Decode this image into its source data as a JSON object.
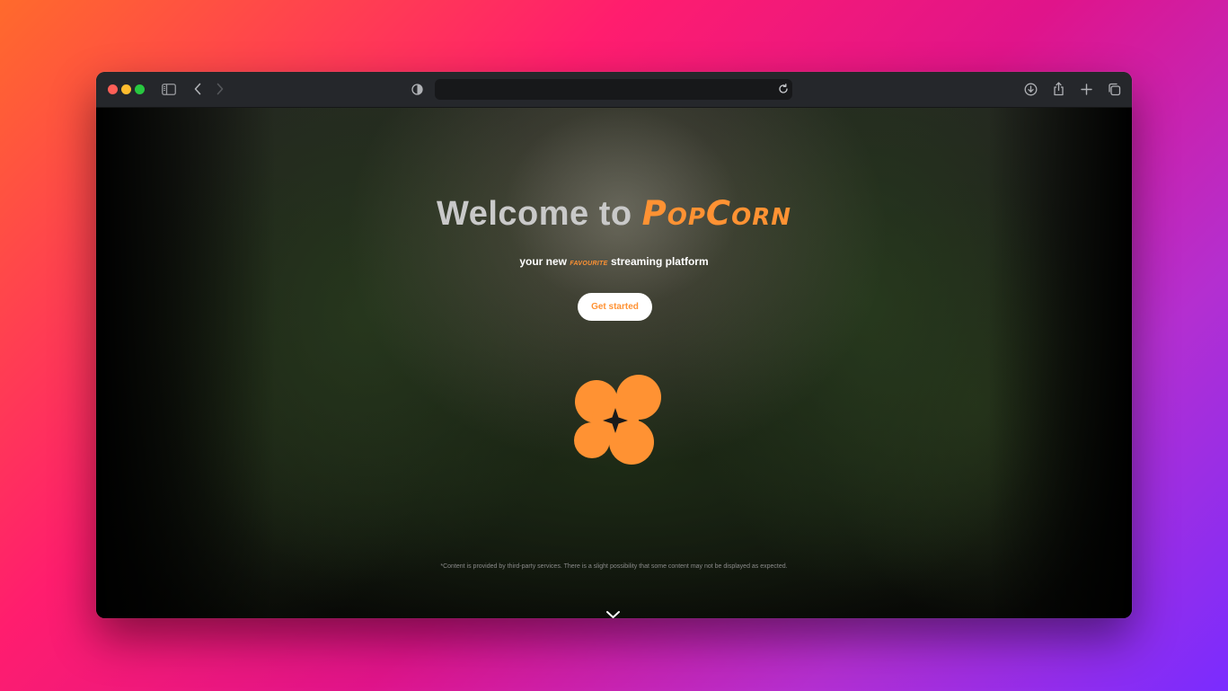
{
  "browser": {
    "url": "",
    "icons": {
      "sidebar": "sidebar-icon",
      "back": "chevron-left-icon",
      "forward": "chevron-right-icon",
      "privacy": "shield-icon",
      "reload": "reload-icon",
      "downloads": "download-icon",
      "share": "share-icon",
      "new_tab": "plus-icon",
      "tabs": "tabs-overview-icon"
    }
  },
  "hero": {
    "headline_prefix": "Welcome to ",
    "brand_name": "PopCorn",
    "subtitle_prefix": "your new ",
    "subtitle_accent": "favourite",
    "subtitle_suffix": " streaming platform",
    "cta_label": "Get started",
    "disclaimer": "*Content is provided by third-party services. There is a slight possibility that some content may not be displayed as expected.",
    "scroll_icon": "chevron-down-icon",
    "logo_icon": "popcorn-logo-icon"
  },
  "colors": {
    "accent": "#ff9233",
    "headline": "#c9c9c9",
    "toolbar": "#25272b",
    "background_gradient_start": "#ff6a2c",
    "background_gradient_end": "#7a2cff"
  }
}
